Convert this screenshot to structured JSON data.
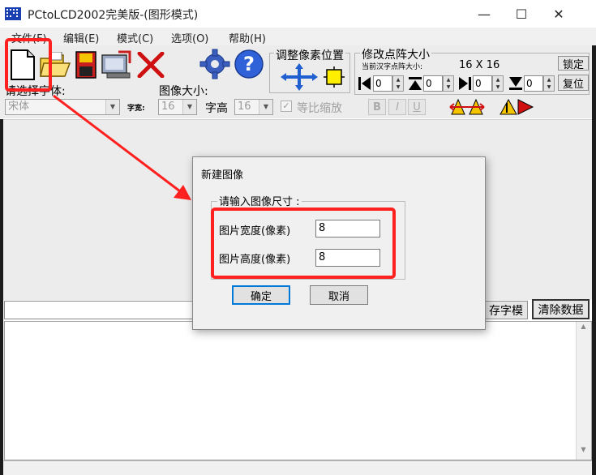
{
  "window": {
    "title": "PCtoLCD2002完美版-(图形模式)",
    "min_glyph": "—",
    "max_glyph": "☐",
    "close_glyph": "✕"
  },
  "menu": [
    {
      "label": "文件(F)"
    },
    {
      "label": "编辑(E)"
    },
    {
      "label": "模式(C)"
    },
    {
      "label": "选项(O)"
    },
    {
      "label": "帮助(H)"
    }
  ],
  "toolbar": {
    "adjust_pixel_label": "调整像素位置",
    "matrix_group_label": "修改点阵大小",
    "current_matrix_label": "当前汉字点阵大小:",
    "current_matrix_value": "16 X 16",
    "lock_label": "锁定",
    "reset_label": "复位",
    "font_select_label": "请选择字体:",
    "font_value": "宋体",
    "char_width_label": "字宽:",
    "char_width_value": "16",
    "image_size_label": "图像大小:",
    "char_height_label": "字高",
    "char_height_value": "16",
    "proportional_label": "等比缩放",
    "spin_values": [
      "0",
      "0",
      "0",
      "0"
    ],
    "bold_label": "B",
    "italic_label": "I",
    "underline_label": "U"
  },
  "bottom": {
    "save_font_label": "存字模",
    "clear_data_label": "清除数据"
  },
  "dialog": {
    "title": "新建图像",
    "group_label": "请输入图像尺寸 :",
    "width_label": "图片宽度(像素)",
    "width_value": "8",
    "height_label": "图片高度(像素)",
    "height_value": "8",
    "ok_label": "确定",
    "cancel_label": "取消"
  },
  "colors": {
    "annotation_red": "#ff2020",
    "toolbar_bg": "#ececec"
  }
}
